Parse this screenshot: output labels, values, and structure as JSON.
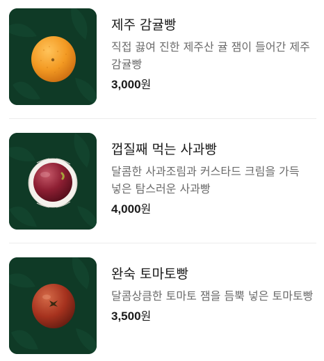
{
  "menu": {
    "items": [
      {
        "name": "제주 감귤빵",
        "description": "직접 끓여 진한 제주산 귤 잼이 들어간 제주 감귤빵",
        "price": "3,000",
        "currency": "원",
        "image_icon": "tangerine-bread-icon"
      },
      {
        "name": "껍질째 먹는 사과빵",
        "description": "달콤한 사과조림과 커스타드 크림을 가득 넣은 탐스러운 사과빵",
        "price": "4,000",
        "currency": "원",
        "image_icon": "apple-bread-icon"
      },
      {
        "name": "완숙 토마토빵",
        "description": "달콤상큼한 토마토 잼을 듬뿍 넣은 토마토빵",
        "price": "3,500",
        "currency": "원",
        "image_icon": "tomato-bread-icon"
      }
    ]
  },
  "colors": {
    "thumb_background": "#0f3a26",
    "price_text": "#1a1a1a",
    "description_text": "#6b6b6b"
  }
}
